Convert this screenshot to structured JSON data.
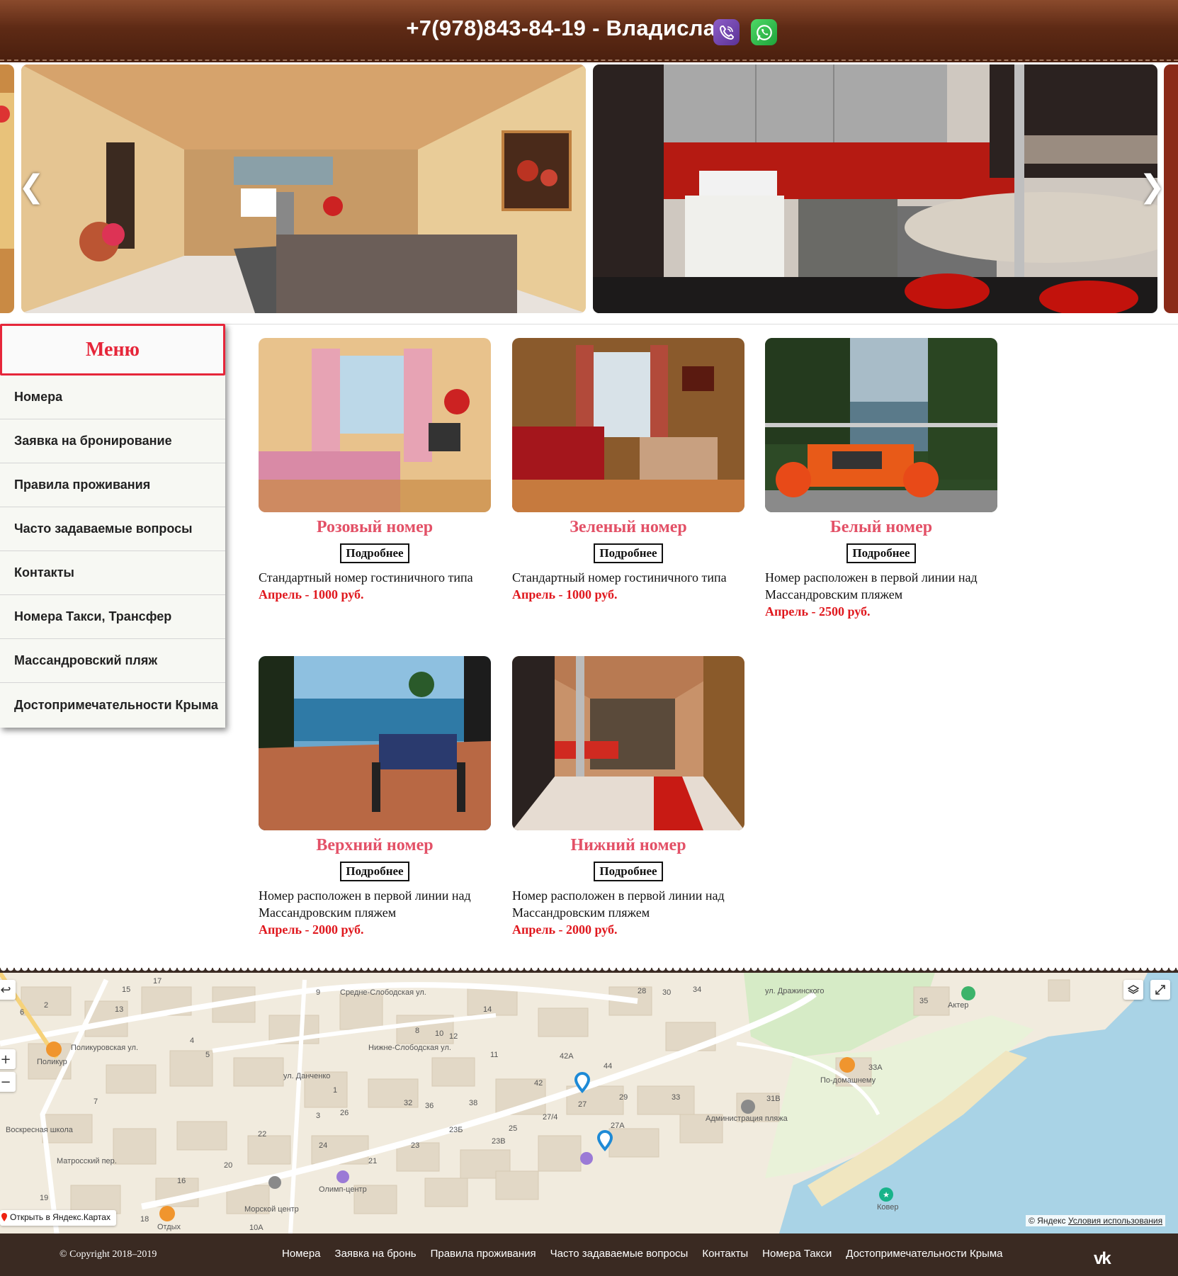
{
  "header": {
    "phone": "+7(978)843-84-19 - Владислав",
    "viber_icon": "viber-icon",
    "whatsapp_icon": "whatsapp-icon"
  },
  "slider": {
    "prev": "❮",
    "next": "❯"
  },
  "menu": {
    "title": "Меню",
    "items": [
      "Номера",
      "Заявка на бронирование",
      "Правила проживания",
      "Часто задаваемые вопросы",
      "Контакты",
      "Номера Такси, Трансфер",
      "Массандровский пляж",
      "Достопримечательности Крыма"
    ]
  },
  "rooms": [
    {
      "name": "Розовый номер",
      "button": "Подробнее",
      "desc": "Стандартный номер гостиничного типа",
      "price": "Апрель - 1000 руб."
    },
    {
      "name": "Зеленый номер",
      "button": "Подробнее",
      "desc": "Стандартный номер гостиничного типа",
      "price": "Апрель - 1000 руб."
    },
    {
      "name": "Белый номер",
      "button": "Подробнее",
      "desc": "Номер расположен в первой линии над Массандровским пляжем",
      "price": "Апрель - 2500 руб."
    },
    {
      "name": "Верхний номер",
      "button": "Подробнее",
      "desc": "Номер расположен в первой линии над Массандровским пляжем",
      "price": "Апрель - 2000 руб."
    },
    {
      "name": "Нижний номер",
      "button": "Подробнее",
      "desc": "Номер расположен в первой линии над Массандровским пляжем",
      "price": "Апрель - 2000 руб."
    }
  ],
  "map": {
    "open_link": "Открыть в Яндекс.Картах",
    "copyright": "© Яндекс",
    "terms": "Условия использования",
    "zoom_in": "+",
    "zoom_out": "−",
    "labels": [
      "Средне-Слободская ул.",
      "ул. Дражинского",
      "Нижне-Слободская ул.",
      "ул. Данченко",
      "Поликуровская ул.",
      "Матросский пер.",
      "Поликур",
      "Воскресная школа",
      "Олимп-центр",
      "Морской центр",
      "Отдых",
      "По-домашнему",
      "Администрация пляжа",
      "Актер",
      "Ковер",
      "33А",
      "31В",
      "27А",
      "27/4",
      "23Б",
      "23В",
      "42А",
      "44",
      "29",
      "33",
      "35",
      "28",
      "30",
      "34",
      "15",
      "17",
      "13",
      "9",
      "8",
      "10",
      "12",
      "14",
      "11",
      "21",
      "22",
      "24",
      "20",
      "16",
      "19",
      "26",
      "32",
      "36",
      "38",
      "25",
      "23",
      "27",
      "42",
      "1",
      "3",
      "4",
      "5",
      "6",
      "7",
      "2",
      "10А",
      "18"
    ]
  },
  "footer": {
    "copyright": "© Copyright 2018–2019",
    "links": [
      "Номера",
      "Заявка на бронь",
      "Правила проживания",
      "Часто задаваемые вопросы",
      "Контакты",
      "Номера Такси",
      "Достопримечательности Крыма"
    ],
    "vk": "vk"
  }
}
